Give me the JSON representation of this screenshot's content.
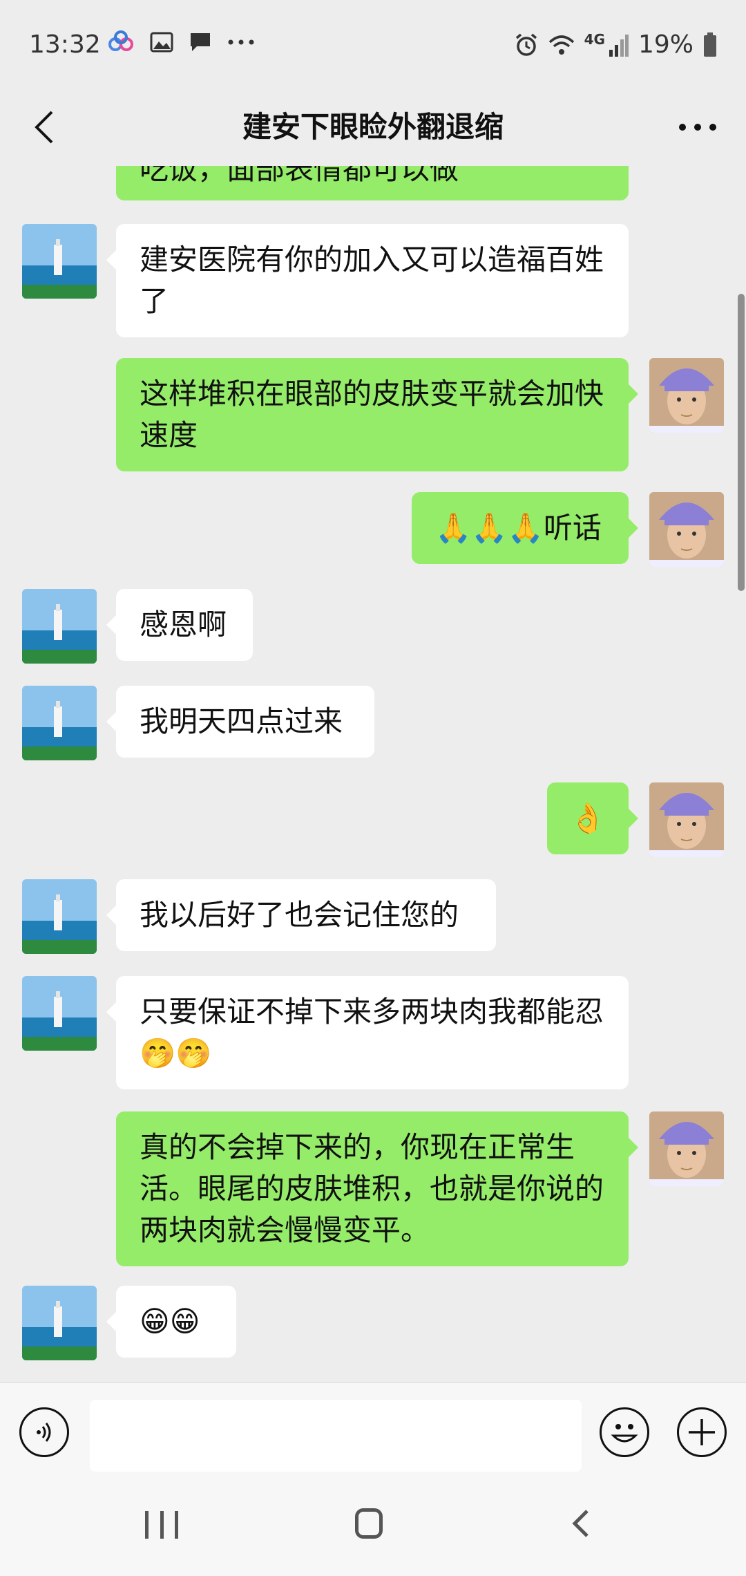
{
  "status_bar": {
    "time": "13:32",
    "battery": "19%",
    "network": "4G",
    "icons": [
      "cloud-icon",
      "image-icon",
      "message-icon",
      "more-dots-icon",
      "alarm-icon",
      "wifi-icon",
      "signal-icon",
      "battery-icon"
    ]
  },
  "header": {
    "title": "建安下眼睑外翻退缩"
  },
  "messages": [
    {
      "side": "out",
      "text": "吃饭，面部表情都可以做",
      "partial": true
    },
    {
      "side": "in",
      "text": "建安医院有你的加入又可以造福百姓了"
    },
    {
      "side": "out",
      "text": "这样堆积在眼部的皮肤变平就会加快速度"
    },
    {
      "side": "out",
      "text": "🙏🙏🙏听话"
    },
    {
      "side": "in",
      "text": "感恩啊"
    },
    {
      "side": "in",
      "text": "我明天四点过来"
    },
    {
      "side": "out",
      "text": "👌"
    },
    {
      "side": "in",
      "text": "我以后好了也会记住您的"
    },
    {
      "side": "in",
      "text": "只要保证不掉下来多两块肉我都能忍🤭🤭"
    },
    {
      "side": "out",
      "text": "真的不会掉下来的，你现在正常生活。眼尾的皮肤堆积，也就是你说的两块肉就会慢慢变平。"
    },
    {
      "side": "in",
      "text": "😁😁"
    }
  ],
  "input_bar": {
    "placeholder": "",
    "value": ""
  },
  "colors": {
    "background": "#ededed",
    "bubble_out": "#95ec69",
    "bubble_in": "#ffffff"
  }
}
